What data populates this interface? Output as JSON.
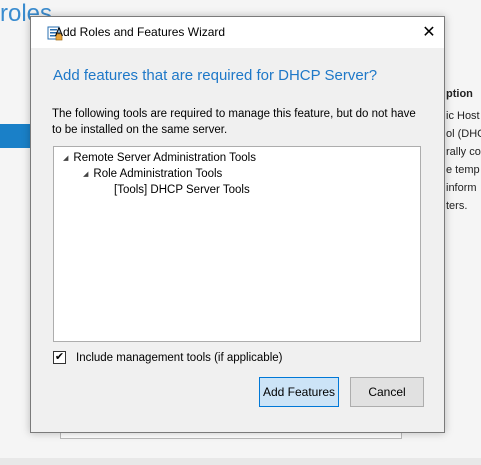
{
  "background": {
    "title": "roles",
    "right_heading": "ption",
    "right_lines": [
      "ic Host",
      "ol (DHC",
      "rally co",
      "e temp",
      " inform",
      "ters."
    ]
  },
  "dialog": {
    "title": "Add Roles and Features Wizard",
    "close_glyph": "✕",
    "heading": "Add features that are required for DHCP Server?",
    "description": "The following tools are required to manage this feature, but do not have to be installed on the same server.",
    "tree": [
      {
        "label": "Remote Server Administration Tools",
        "expanded": true
      },
      {
        "label": "Role Administration Tools",
        "expanded": true
      },
      {
        "label": "[Tools] DHCP Server Tools",
        "expanded": false
      }
    ],
    "checkbox": {
      "label": "Include management tools (if applicable)",
      "checked": true,
      "mark": "✔"
    },
    "buttons": {
      "add": "Add Features",
      "cancel": "Cancel"
    }
  },
  "colors": {
    "accent": "#1e78c8",
    "primary_button": "#cce4f7",
    "primary_border": "#0078d7"
  }
}
